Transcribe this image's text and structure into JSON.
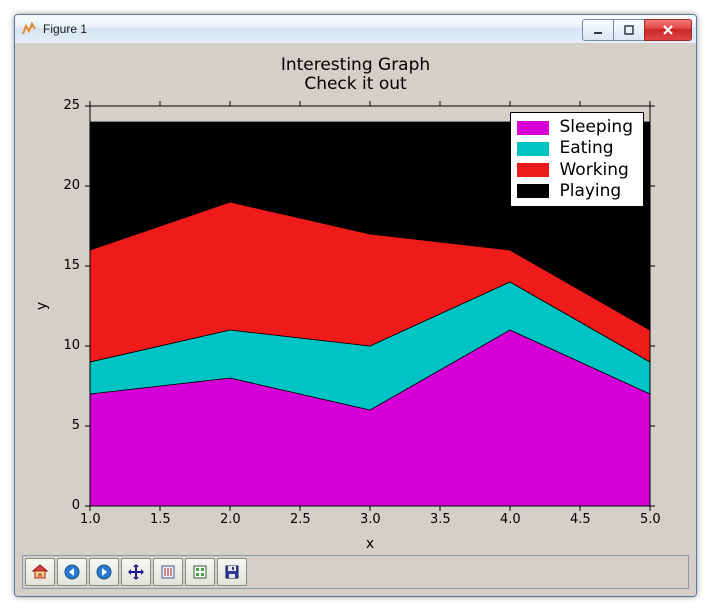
{
  "window": {
    "title": "Figure 1",
    "buttons": {
      "min": "Minimize",
      "max": "Maximize",
      "close": "Close"
    }
  },
  "chart_data": {
    "type": "area",
    "stacked": true,
    "title": "Interesting Graph",
    "subtitle": "Check it out",
    "xlabel": "x",
    "ylabel": "y",
    "xlim": [
      1,
      5
    ],
    "ylim": [
      0,
      25
    ],
    "xticks": [
      1.0,
      1.5,
      2.0,
      2.5,
      3.0,
      3.5,
      4.0,
      4.5,
      5.0
    ],
    "yticks": [
      0,
      5,
      10,
      15,
      20,
      25
    ],
    "categories": [
      1,
      2,
      3,
      4,
      5
    ],
    "series": [
      {
        "name": "Sleeping",
        "color": "#d500d5",
        "values": [
          7,
          8,
          6,
          11,
          7
        ]
      },
      {
        "name": "Eating",
        "color": "#00c4c4",
        "values": [
          2,
          3,
          4,
          3,
          2
        ]
      },
      {
        "name": "Working",
        "color": "#ef1a1a",
        "values": [
          7,
          8,
          7,
          2,
          2
        ]
      },
      {
        "name": "Playing",
        "color": "#000000",
        "values": [
          8,
          5,
          7,
          8,
          13
        ]
      }
    ],
    "legend": {
      "position": "upper right"
    }
  },
  "toolbar": {
    "items": [
      {
        "name": "home",
        "label": "Home"
      },
      {
        "name": "back",
        "label": "Back"
      },
      {
        "name": "forward",
        "label": "Forward"
      },
      {
        "name": "pan",
        "label": "Pan"
      },
      {
        "name": "zoom",
        "label": "Zoom"
      },
      {
        "name": "subplots",
        "label": "Configure subplots"
      },
      {
        "name": "save",
        "label": "Save figure"
      }
    ]
  }
}
